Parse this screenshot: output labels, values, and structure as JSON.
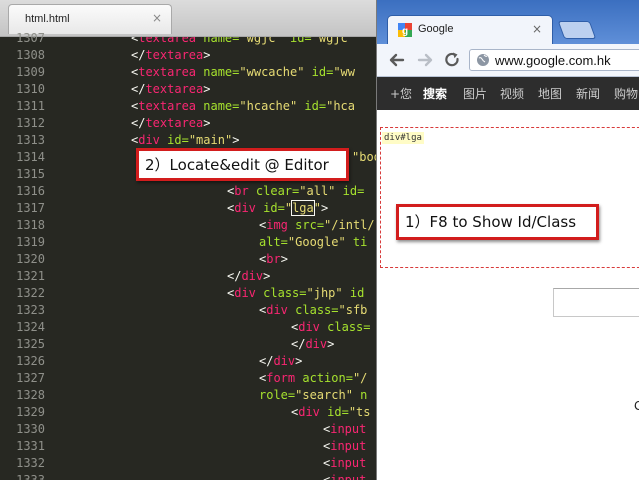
{
  "editor": {
    "tab": {
      "label": "html.html",
      "close_glyph": "×"
    },
    "line_numbers": [
      "1307",
      "1308",
      "1309",
      "1310",
      "1311",
      "1312",
      "1313",
      "1314",
      "1315",
      "1316",
      "1317",
      "1318",
      "1319",
      "1320",
      "1321",
      "1322",
      "1323",
      "1324",
      "1325",
      "1326",
      "1327",
      "1328",
      "1329",
      "1330",
      "1331",
      "1332",
      "1333"
    ],
    "lines": {
      "l1307": {
        "open": "<",
        "tag": "textarea",
        "attr1": " name=",
        "val1": "\"wgjc\"",
        "attr2": " id=",
        "val2": "\"wgjc\""
      },
      "l1308": {
        "close": "</",
        "tag": "textarea",
        "end": ">"
      },
      "l1309": {
        "open": "<",
        "tag": "textarea",
        "attr1": " name=",
        "val1": "\"wwcache\"",
        "attr2": " id=",
        "val2": "\"ww"
      },
      "l1310": {
        "close": "</",
        "tag": "textarea",
        "end": ">"
      },
      "l1311": {
        "open": "<",
        "tag": "textarea",
        "attr1": " name=",
        "val1": "\"hcache\"",
        "attr2": " id=",
        "val2": "\"hca"
      },
      "l1312": {
        "close": "</",
        "tag": "textarea",
        "end": ">"
      },
      "l1313": {
        "open": "<",
        "tag": "div",
        "attr1": " id=",
        "val1": "\"main\"",
        "end": ">"
      },
      "l1314": {
        "tail": "\"boo"
      },
      "l1316": {
        "open": "<",
        "tag": "br",
        "attr1": " clear=",
        "val1": "\"all\"",
        "attr2": " id="
      },
      "l1317": {
        "open": "<",
        "tag": "div",
        "attr1": " id=",
        "q1": "\"",
        "hl": "lga",
        "q2": "\"",
        "end": ">"
      },
      "l1318": {
        "open": "<",
        "tag": "img",
        "attr1": " src=",
        "val1": "\"/intl/"
      },
      "l1319": {
        "attr1": "alt=",
        "val1": "\"Google\"",
        "attr2": " ti"
      },
      "l1320": {
        "open": "<",
        "tag": "br",
        "end": ">"
      },
      "l1321": {
        "close": "</",
        "tag": "div",
        "end": ">"
      },
      "l1322": {
        "open": "<",
        "tag": "div",
        "attr1": " class=",
        "val1": "\"jhp\"",
        "attr2": " id"
      },
      "l1323": {
        "open": "<",
        "tag": "div",
        "attr1": " class=",
        "val1": "\"sfb"
      },
      "l1324": {
        "open": "<",
        "tag": "div",
        "attr1": " class="
      },
      "l1325": {
        "close": "</",
        "tag": "div",
        "end": ">"
      },
      "l1326": {
        "close": "</",
        "tag": "div",
        "end": ">"
      },
      "l1327": {
        "open": "<",
        "tag": "form",
        "attr1": " action=",
        "val1": "\"/"
      },
      "l1328": {
        "attr1": "role=",
        "val1": "\"search\"",
        "attr2": " n"
      },
      "l1329": {
        "open": "<",
        "tag": "div",
        "attr1": " id=",
        "val1": "\"ts"
      },
      "l1330": {
        "open": "<",
        "tag": "input"
      },
      "l1331": {
        "open": "<",
        "tag": "input"
      },
      "l1332": {
        "open": "<",
        "tag": "input"
      },
      "l1333": {
        "open": "<",
        "tag": "input"
      }
    }
  },
  "browser": {
    "tab": {
      "label": "Google",
      "close_glyph": "×"
    },
    "toolbar": {
      "back_icon": "back-arrow-icon",
      "forward_icon": "forward-arrow-icon",
      "reload_icon": "reload-icon"
    },
    "omnibox": {
      "url": "www.google.com.hk"
    },
    "gbar": [
      "+您",
      "搜索",
      "图片",
      "视频",
      "地图",
      "新闻",
      "购物"
    ],
    "page": {
      "element_tag": "div#lga",
      "letter": "C"
    }
  },
  "callouts": {
    "editor": "2）Locate&edit @ Editor",
    "browser": "1）F8 to Show Id/Class"
  },
  "colors": {
    "callout_border": "#d21d1d",
    "editor_bg": "#272822",
    "tag": "#f92672",
    "attr": "#a6e22e",
    "string": "#e6db74",
    "chrome_frame": "#3b6fc0"
  }
}
